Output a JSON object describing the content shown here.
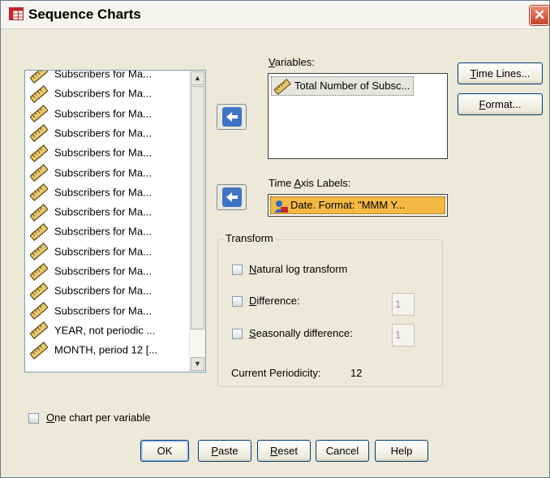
{
  "window": {
    "title": "Sequence Charts",
    "close_glyph": "✕"
  },
  "source_list": {
    "items": [
      {
        "label": "Subscribers for Ma...",
        "icon": "ruler-icon"
      },
      {
        "label": "Subscribers for Ma...",
        "icon": "ruler-icon"
      },
      {
        "label": "Subscribers for Ma...",
        "icon": "ruler-icon"
      },
      {
        "label": "Subscribers for Ma...",
        "icon": "ruler-icon"
      },
      {
        "label": "Subscribers for Ma...",
        "icon": "ruler-icon"
      },
      {
        "label": "Subscribers for Ma...",
        "icon": "ruler-icon"
      },
      {
        "label": "Subscribers for Ma...",
        "icon": "ruler-icon"
      },
      {
        "label": "Subscribers for Ma...",
        "icon": "ruler-icon"
      },
      {
        "label": "Subscribers for Ma...",
        "icon": "ruler-icon"
      },
      {
        "label": "Subscribers for Ma...",
        "icon": "ruler-icon"
      },
      {
        "label": "Subscribers for Ma...",
        "icon": "ruler-icon"
      },
      {
        "label": "Subscribers for Ma...",
        "icon": "ruler-icon"
      },
      {
        "label": "Subscribers for Ma...",
        "icon": "ruler-icon"
      },
      {
        "label": "YEAR, not periodic ...",
        "icon": "ruler-icon"
      },
      {
        "label": "MONTH, period 12 [...",
        "icon": "ruler-icon"
      }
    ]
  },
  "variables": {
    "label_pre": "",
    "label_key": "V",
    "label_post": "ariables:",
    "items": [
      {
        "label": "Total Number of Subsc...",
        "icon": "ruler-icon"
      }
    ]
  },
  "time_axis": {
    "label_pre": "Time ",
    "label_key": "A",
    "label_post": "xis Labels:",
    "value": "Date.  Format:  \"MMM Y...",
    "icon": "date-variable-icon"
  },
  "transform": {
    "title": "Transform",
    "natural_log": {
      "pre": "",
      "key": "N",
      "post": "atural log transform",
      "checked": false
    },
    "difference": {
      "pre": "",
      "key": "D",
      "post": "ifference:",
      "checked": false,
      "value": "1"
    },
    "seasonal": {
      "pre": "",
      "key": "S",
      "post": "easonally difference:",
      "checked": false,
      "value": "1"
    },
    "periodicity_label": "Current Periodicity:",
    "periodicity_value": "12"
  },
  "one_chart": {
    "pre": "",
    "key": "O",
    "post": "ne chart per variable",
    "checked": false
  },
  "side_buttons": {
    "time_lines": {
      "pre": "",
      "key": "T",
      "post": "ime Lines..."
    },
    "format": {
      "pre": "",
      "key": "F",
      "post": "ormat..."
    }
  },
  "bottom_buttons": {
    "ok": "OK",
    "paste": {
      "pre": "",
      "key": "P",
      "post": "aste"
    },
    "reset": {
      "pre": "",
      "key": "R",
      "post": "eset"
    },
    "cancel": "Cancel",
    "help": "Help"
  }
}
